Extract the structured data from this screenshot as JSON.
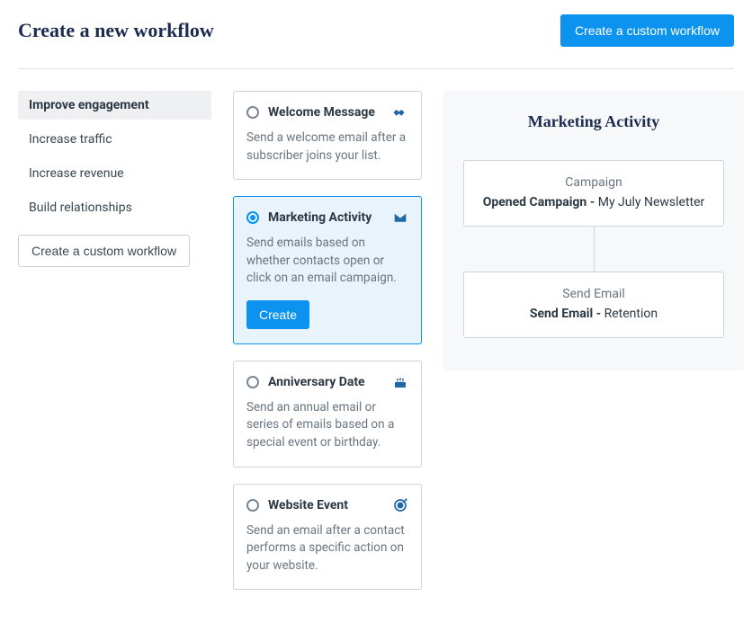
{
  "header": {
    "title": "Create a new workflow",
    "create_custom_label": "Create a custom workflow"
  },
  "sidebar": {
    "items": [
      {
        "label": "Improve engagement",
        "active": true
      },
      {
        "label": "Increase traffic",
        "active": false
      },
      {
        "label": "Increase revenue",
        "active": false
      },
      {
        "label": "Build relationships",
        "active": false
      }
    ],
    "custom_label": "Create a custom workflow"
  },
  "cards": [
    {
      "title": "Welcome Message",
      "desc": "Send a welcome email after a subscriber joins your list.",
      "icon": "handshake-icon",
      "selected": false
    },
    {
      "title": "Marketing Activity",
      "desc": "Send emails based on whether contacts open or click on an email campaign.",
      "icon": "envelope-icon",
      "selected": true,
      "create_label": "Create"
    },
    {
      "title": "Anniversary Date",
      "desc": "Send an annual email or series of emails based on a special event or birthday.",
      "icon": "cake-icon",
      "selected": false
    },
    {
      "title": "Website Event",
      "desc": "Send an email after a contact performs a specific action on your website.",
      "icon": "target-icon",
      "selected": false
    }
  ],
  "preview": {
    "title": "Marketing Activity",
    "nodes": [
      {
        "top": "Campaign",
        "bold": "Opened Campaign -",
        "rest": " My July Newsletter"
      },
      {
        "top": "Send Email",
        "bold": "Send Email -",
        "rest": " Retention"
      }
    ]
  }
}
